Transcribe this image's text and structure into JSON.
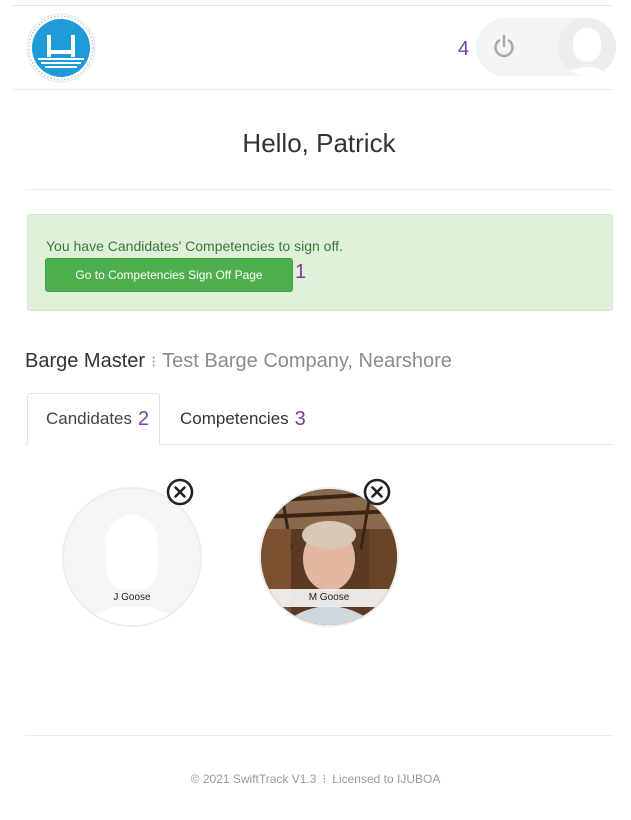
{
  "header": {
    "logo_icon": "barge-operators-logo-icon",
    "logout_step": "4",
    "power_icon": "power-icon",
    "avatar_icon": "user-avatar-icon"
  },
  "greeting": "Hello, Patrick",
  "alert": {
    "message": "You have Candidates' Competencies to sign off.",
    "button_label": "Go to Competencies Sign Off Page",
    "step": "1"
  },
  "role": {
    "title": "Barge Master",
    "separator": "⁝",
    "company": "Test Barge Company, Nearshore"
  },
  "tabs": [
    {
      "label": "Candidates",
      "step": "2",
      "active": true
    },
    {
      "label": "Competencies",
      "step": "3",
      "active": false
    }
  ],
  "candidates": [
    {
      "name": "J Goose",
      "photo": "placeholder"
    },
    {
      "name": "M Goose",
      "photo": "portrait"
    }
  ],
  "footer": {
    "copyright": "© 2021 SwiftTrack V1.3",
    "separator": "⁝",
    "license": "Licensed to IJUBOA"
  },
  "colors": {
    "success_bg": "#dff0d8",
    "success_text": "#3c763d",
    "button_green": "#4cae4c",
    "step_number": "#7a3f9e",
    "logo_blue": "#1f9bd7"
  }
}
